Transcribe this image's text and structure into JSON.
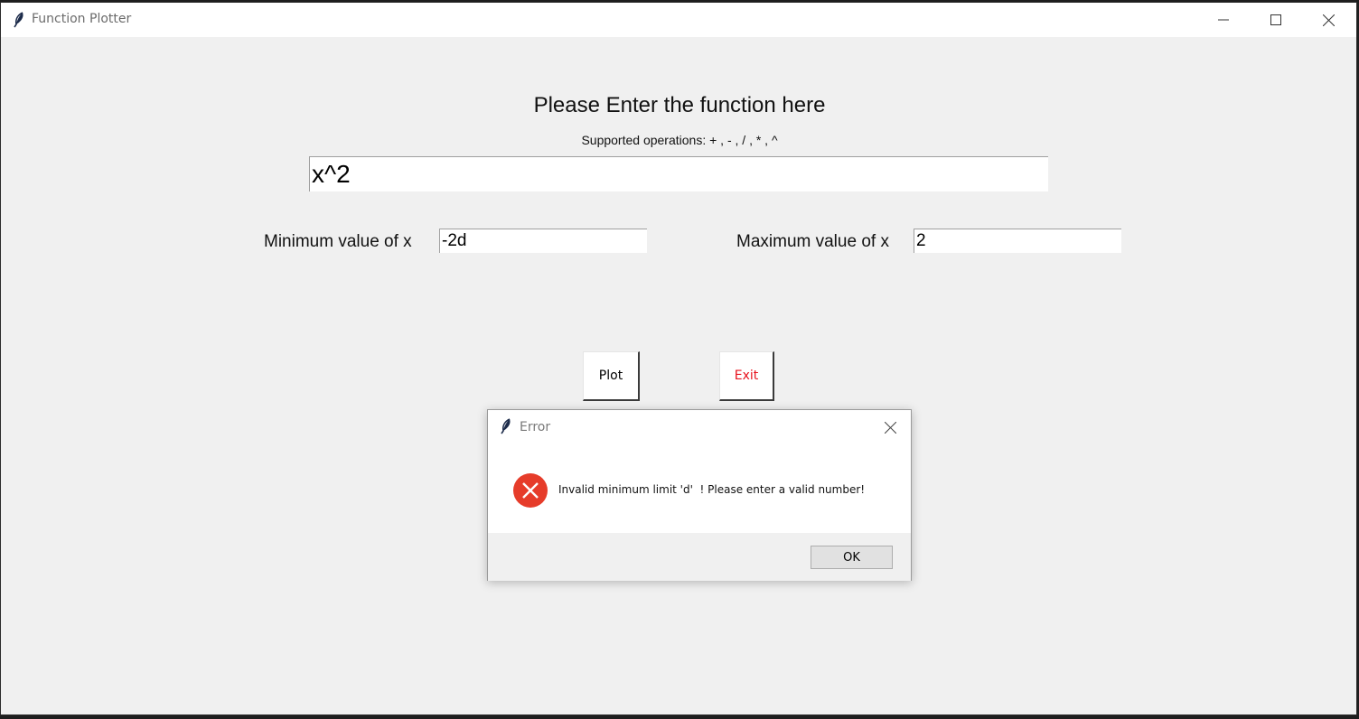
{
  "window": {
    "title": "Function Plotter",
    "controls": {
      "minimize": "minimize-icon",
      "maximize": "maximize-icon",
      "close": "close-icon"
    }
  },
  "form": {
    "heading": "Please Enter the function here",
    "subheading": "Supported operations: + , - , / , * , ^",
    "function_value": "x^2",
    "min_label": "Minimum value of x",
    "min_value": "-2d",
    "max_label": "Maximum value of x",
    "max_value": "2"
  },
  "buttons": {
    "plot_label": "Plot",
    "exit_label": "Exit",
    "exit_color": "#e8121d"
  },
  "dialog": {
    "title": "Error",
    "message": "Invalid minimum limit 'd'  ! Please enter a valid number!",
    "ok_label": "OK",
    "icon": "error-icon",
    "icon_color": "#e63c2a"
  }
}
